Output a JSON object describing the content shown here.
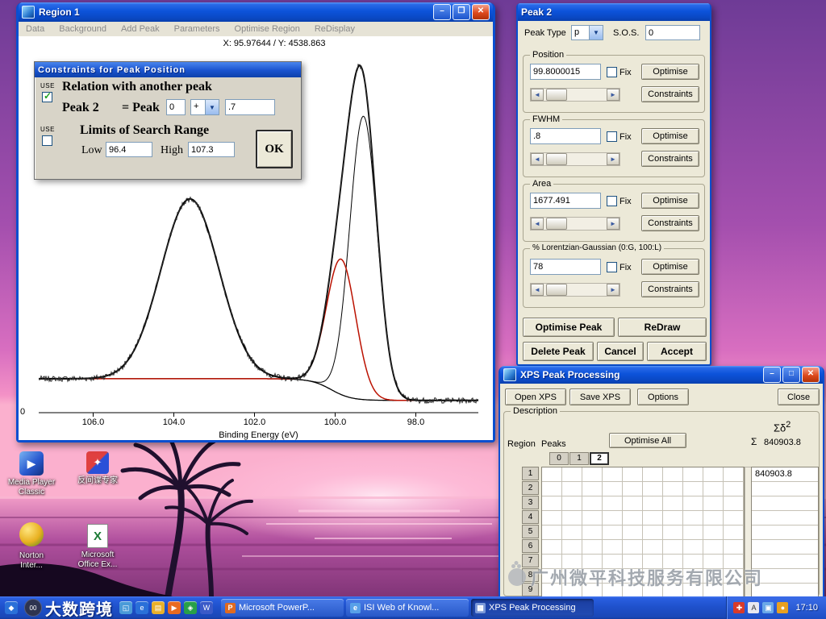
{
  "desktop": {
    "icons": [
      {
        "name": "media-player-classic",
        "label": "Media Player\nClassic"
      },
      {
        "name": "anti-spy-expert",
        "label": "反间谍专家"
      },
      {
        "name": "norton-internet-security",
        "label": "Norton\nInter..."
      },
      {
        "name": "microsoft-office-excel",
        "label": "Microsoft\nOffice Ex..."
      }
    ],
    "watermark": {
      "badge": "00",
      "text": "大数跨境"
    }
  },
  "region_window": {
    "title": "Region 1",
    "menu": [
      "Data",
      "Background",
      "Add Peak",
      "Parameters",
      "Optimise Region",
      "ReDisplay"
    ],
    "coords": "X: 95.97644 / Y: 4538.863"
  },
  "chart_data": {
    "type": "line",
    "title": "",
    "xlabel": "Binding Energy (eV)",
    "x_range": [
      107.35,
      96.45
    ],
    "x_axis_reversed": true,
    "x_ticks": [
      106.0,
      104.0,
      102.0,
      100.0,
      98.0
    ],
    "x_tick_labels": [
      "106.0",
      "104.0",
      "102.0",
      "100.0",
      "98.0"
    ],
    "y_origin_label": "0",
    "y_max": 5000,
    "noise": 80,
    "baseline": {
      "high": 485,
      "low": 175,
      "step_center": 100.1,
      "step_width": 0.25
    },
    "peaks": [
      {
        "name": "broad-peak",
        "center": 103.6,
        "fwhm": 1.7,
        "amplitude": 2570
      },
      {
        "name": "main-component",
        "center": 99.3,
        "fwhm": 0.8,
        "amplitude": 4050
      },
      {
        "name": "red-component",
        "center": 99.85,
        "fwhm": 0.85,
        "amplitude": 1935
      }
    ],
    "series": [
      {
        "name": "experimental",
        "color": "#2a2a2a"
      },
      {
        "name": "envelope",
        "color": "#000000"
      },
      {
        "name": "component-peak",
        "color": "#000000"
      },
      {
        "name": "component-red",
        "color": "#bb1100"
      },
      {
        "name": "baseline",
        "color": "#000000"
      }
    ]
  },
  "constraints_dialog": {
    "title": "Constraints for Peak Position",
    "use_label": "USE",
    "relation_heading": "Relation with another peak",
    "peak_label": "Peak 2",
    "equals_peak_label": "= Peak",
    "relation_peak_value": "0",
    "relation_operator": "+",
    "relation_offset": ".7",
    "limits_heading": "Limits of Search Range",
    "low_label": "Low",
    "low_value": "96.4",
    "high_label": "High",
    "high_value": "107.3",
    "ok_label": "OK"
  },
  "peak_window": {
    "title": "Peak 2",
    "peak_type_label": "Peak Type",
    "peak_type_value": "p",
    "sos_label": "S.O.S.",
    "sos_value": "0",
    "fix_label": "Fix",
    "optimise_label": "Optimise",
    "constraints_label": "Constraints",
    "groups": [
      {
        "name": "Position",
        "value": "99.8000015"
      },
      {
        "name": "FWHM",
        "value": ".8"
      },
      {
        "name": "Area",
        "value": "1677.491"
      },
      {
        "name": "% Lorentzian-Gaussian (0:G, 100:L)",
        "value": "78"
      }
    ],
    "optimise_peak_label": "Optimise Peak",
    "redraw_label": "ReDraw",
    "delete_peak_label": "Delete Peak",
    "cancel_label": "Cancel",
    "accept_label": "Accept"
  },
  "processing_window": {
    "title": "XPS Peak Processing",
    "open_label": "Open XPS",
    "save_label": "Save XPS",
    "options_label": "Options",
    "close_label": "Close",
    "description_label": "Description",
    "region_label": "Region",
    "peaks_label": "Peaks",
    "optimise_all_label": "Optimise All",
    "sigma_delta_label": "Σδ",
    "sigma_delta_sup": "2",
    "sigma_delta_total": "840903.8",
    "sigma_label": "Σ",
    "sum_first_row": "840903.8",
    "row_numbers": [
      "1",
      "2",
      "3",
      "4",
      "5",
      "6",
      "7",
      "8",
      "9"
    ],
    "peak_columns": [
      "0",
      "1",
      "2"
    ],
    "selected_peak": "2",
    "watermark": "广州微平科技服务有限公司"
  },
  "taskbar": {
    "quick_launch": [
      {
        "name": "show-desktop-icon",
        "glyph": "◱",
        "color": "#4a9ad8"
      },
      {
        "name": "internet-explorer-icon",
        "glyph": "e",
        "color": "#2a70d8"
      },
      {
        "name": "folder-icon",
        "glyph": "▤",
        "color": "#e8b02a"
      },
      {
        "name": "media-player-icon",
        "glyph": "▶",
        "color": "#e86a20"
      },
      {
        "name": "messenger-icon",
        "glyph": "◈",
        "color": "#28a048"
      },
      {
        "name": "word-icon",
        "glyph": "W",
        "color": "#3a5ac8"
      }
    ],
    "tasks": [
      {
        "name": "task-microsoft-powerpoint",
        "label": "Microsoft PowerP...",
        "glyph": "P",
        "color": "#e06a20",
        "active": false
      },
      {
        "name": "task-isi-web-of-knowledge",
        "label": "ISI Web of Knowl...",
        "glyph": "e",
        "color": "#58a0e8",
        "active": false
      },
      {
        "name": "task-xps-peak-processing",
        "label": "XPS Peak Processing",
        "glyph": "▦",
        "color": "#7a98d8",
        "active": true
      }
    ],
    "tray_icons": [
      {
        "name": "tray-antivirus-icon",
        "glyph": "✚",
        "color": "#d83a2a"
      },
      {
        "name": "tray-language-icon",
        "glyph": "A",
        "color": "#e8e8f0"
      },
      {
        "name": "tray-network-icon",
        "glyph": "▣",
        "color": "#6aa8e8"
      },
      {
        "name": "tray-update-icon",
        "glyph": "●",
        "color": "#e8a020"
      }
    ],
    "clock": "17:10"
  }
}
